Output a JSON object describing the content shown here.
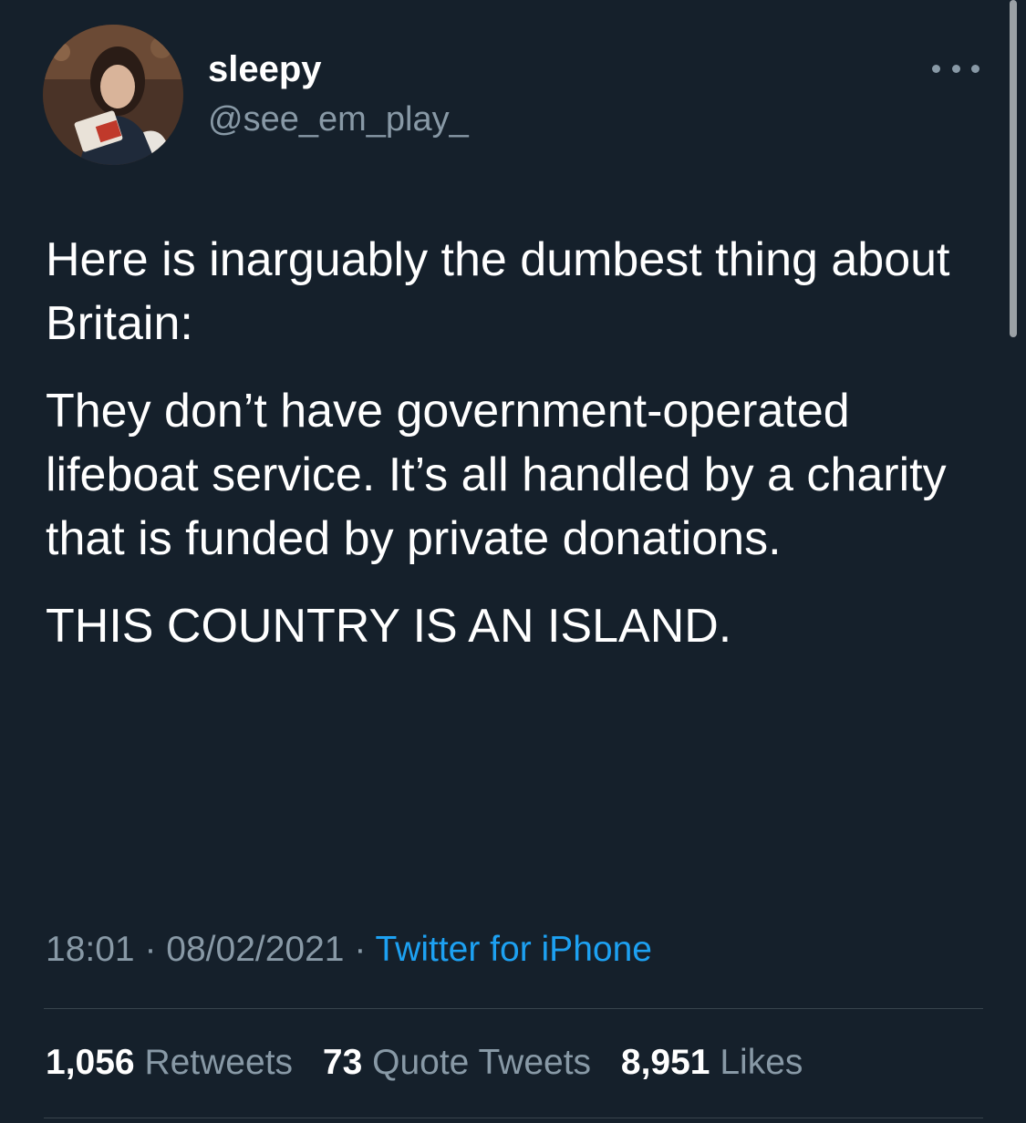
{
  "user": {
    "display_name": "sleepy",
    "handle": "@see_em_play_",
    "avatar": "profile-photo"
  },
  "tweet": {
    "paragraphs": [
      "Here is inarguably the dumbest thing about Britain:",
      "They don’t have government-operated lifeboat service. It’s all handled by a charity that is funded by private donations.",
      "THIS COUNTRY IS AN ISLAND."
    ],
    "time": "18:01",
    "date": "08/02/2021",
    "separator": "·",
    "source": "Twitter for iPhone"
  },
  "stats": {
    "retweets": {
      "count": "1,056",
      "label": "Retweets"
    },
    "quote_tweets": {
      "count": "73",
      "label": "Quote Tweets"
    },
    "likes": {
      "count": "8,951",
      "label": "Likes"
    }
  },
  "colors": {
    "background": "#15202b",
    "text": "#ffffff",
    "secondary": "#8899a6",
    "link": "#1da1f2",
    "divider": "#38444d"
  },
  "icons": {
    "more": "more-horizontal-icon"
  }
}
